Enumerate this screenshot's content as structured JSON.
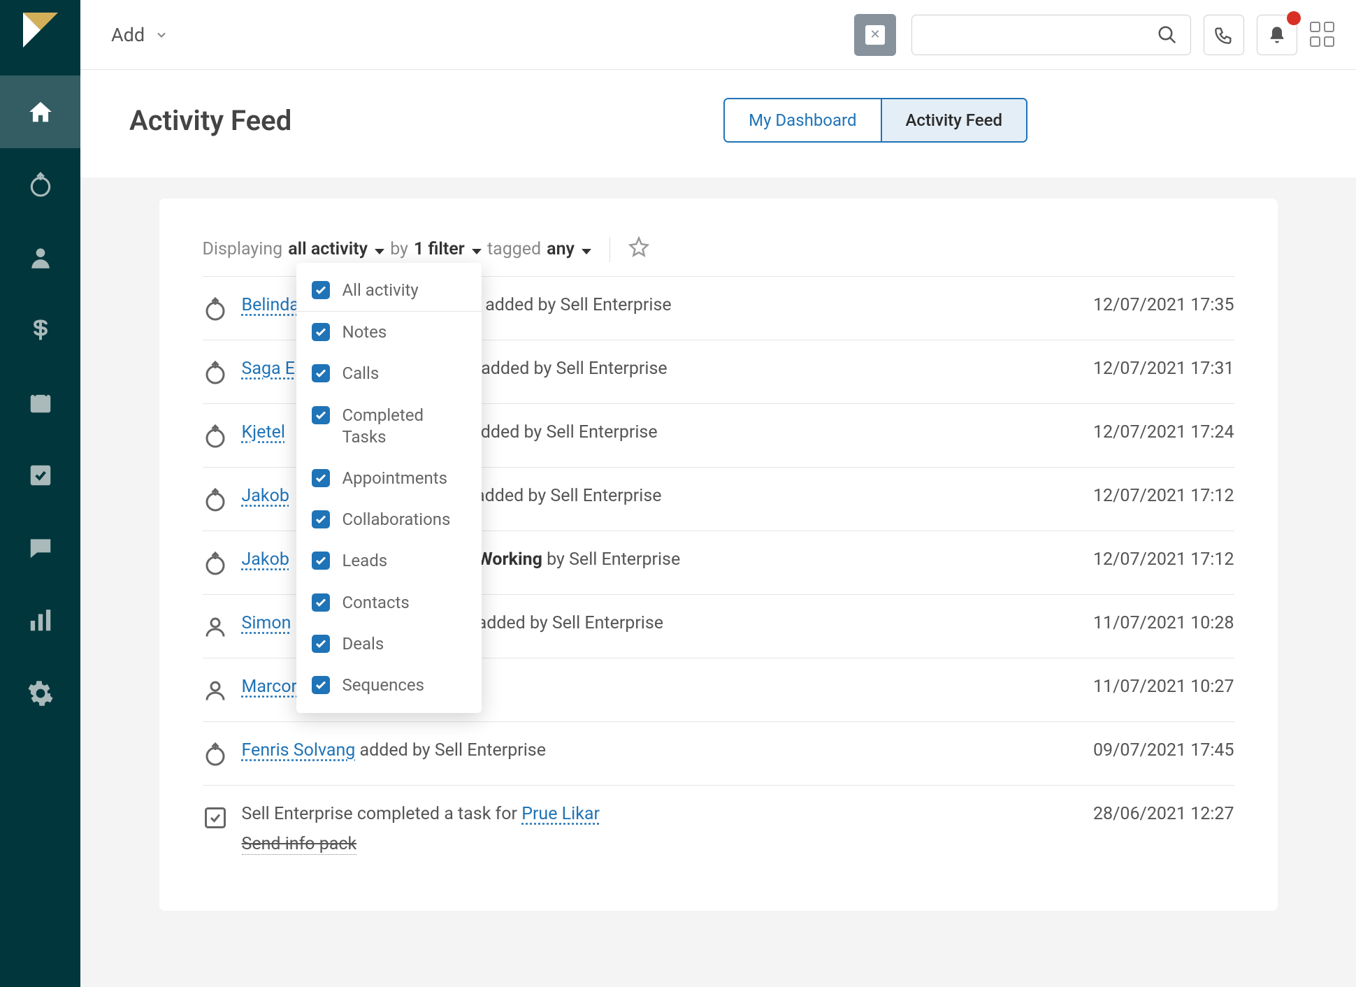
{
  "topbar": {
    "add": "Add"
  },
  "header": {
    "title": "Activity Feed",
    "tabs": {
      "dashboard": "My Dashboard",
      "activity": "Activity Feed"
    }
  },
  "filter": {
    "displaying": "Displaying",
    "allActivity": "all activity",
    "by": "by",
    "filterCount": "1 filter",
    "tagged": "tagged",
    "any": "any"
  },
  "dropdown": {
    "allActivity": "All activity",
    "notes": "Notes",
    "calls": "Calls",
    "completedTasks": "Completed Tasks",
    "appointments": "Appointments",
    "collaborations": "Collaborations",
    "leads": "Leads",
    "contacts": "Contacts",
    "deals": "Deals",
    "sequences": "Sequences"
  },
  "feed": {
    "addedBy": " added by Sell Enterprise",
    "workingBy": " by Sell Enterprise",
    "completedFor": "Sell Enterprise completed a task for ",
    "items": [
      {
        "type": "lead",
        "link": "Belinda",
        "time": "12/07/2021 17:35"
      },
      {
        "type": "lead",
        "link": "Saga E",
        "time": "12/07/2021 17:31"
      },
      {
        "type": "lead",
        "link": "Kjetel",
        "time": "12/07/2021 17:24"
      },
      {
        "type": "lead",
        "link": "Jakob",
        "time": "12/07/2021 17:12"
      },
      {
        "type": "working",
        "link": "Jakob",
        "boldStatus": "s Working",
        "time": "12/07/2021 17:12"
      },
      {
        "type": "contact",
        "link": "Simon",
        "time": "11/07/2021 10:28"
      },
      {
        "type": "contact",
        "link": "Marcor",
        "time": "11/07/2021 10:27"
      },
      {
        "type": "lead",
        "link": "Fenris Solvang",
        "time": "09/07/2021 17:45"
      },
      {
        "type": "task",
        "link": "Prue Likar",
        "task": "Send info pack",
        "time": "28/06/2021 12:27"
      }
    ]
  }
}
